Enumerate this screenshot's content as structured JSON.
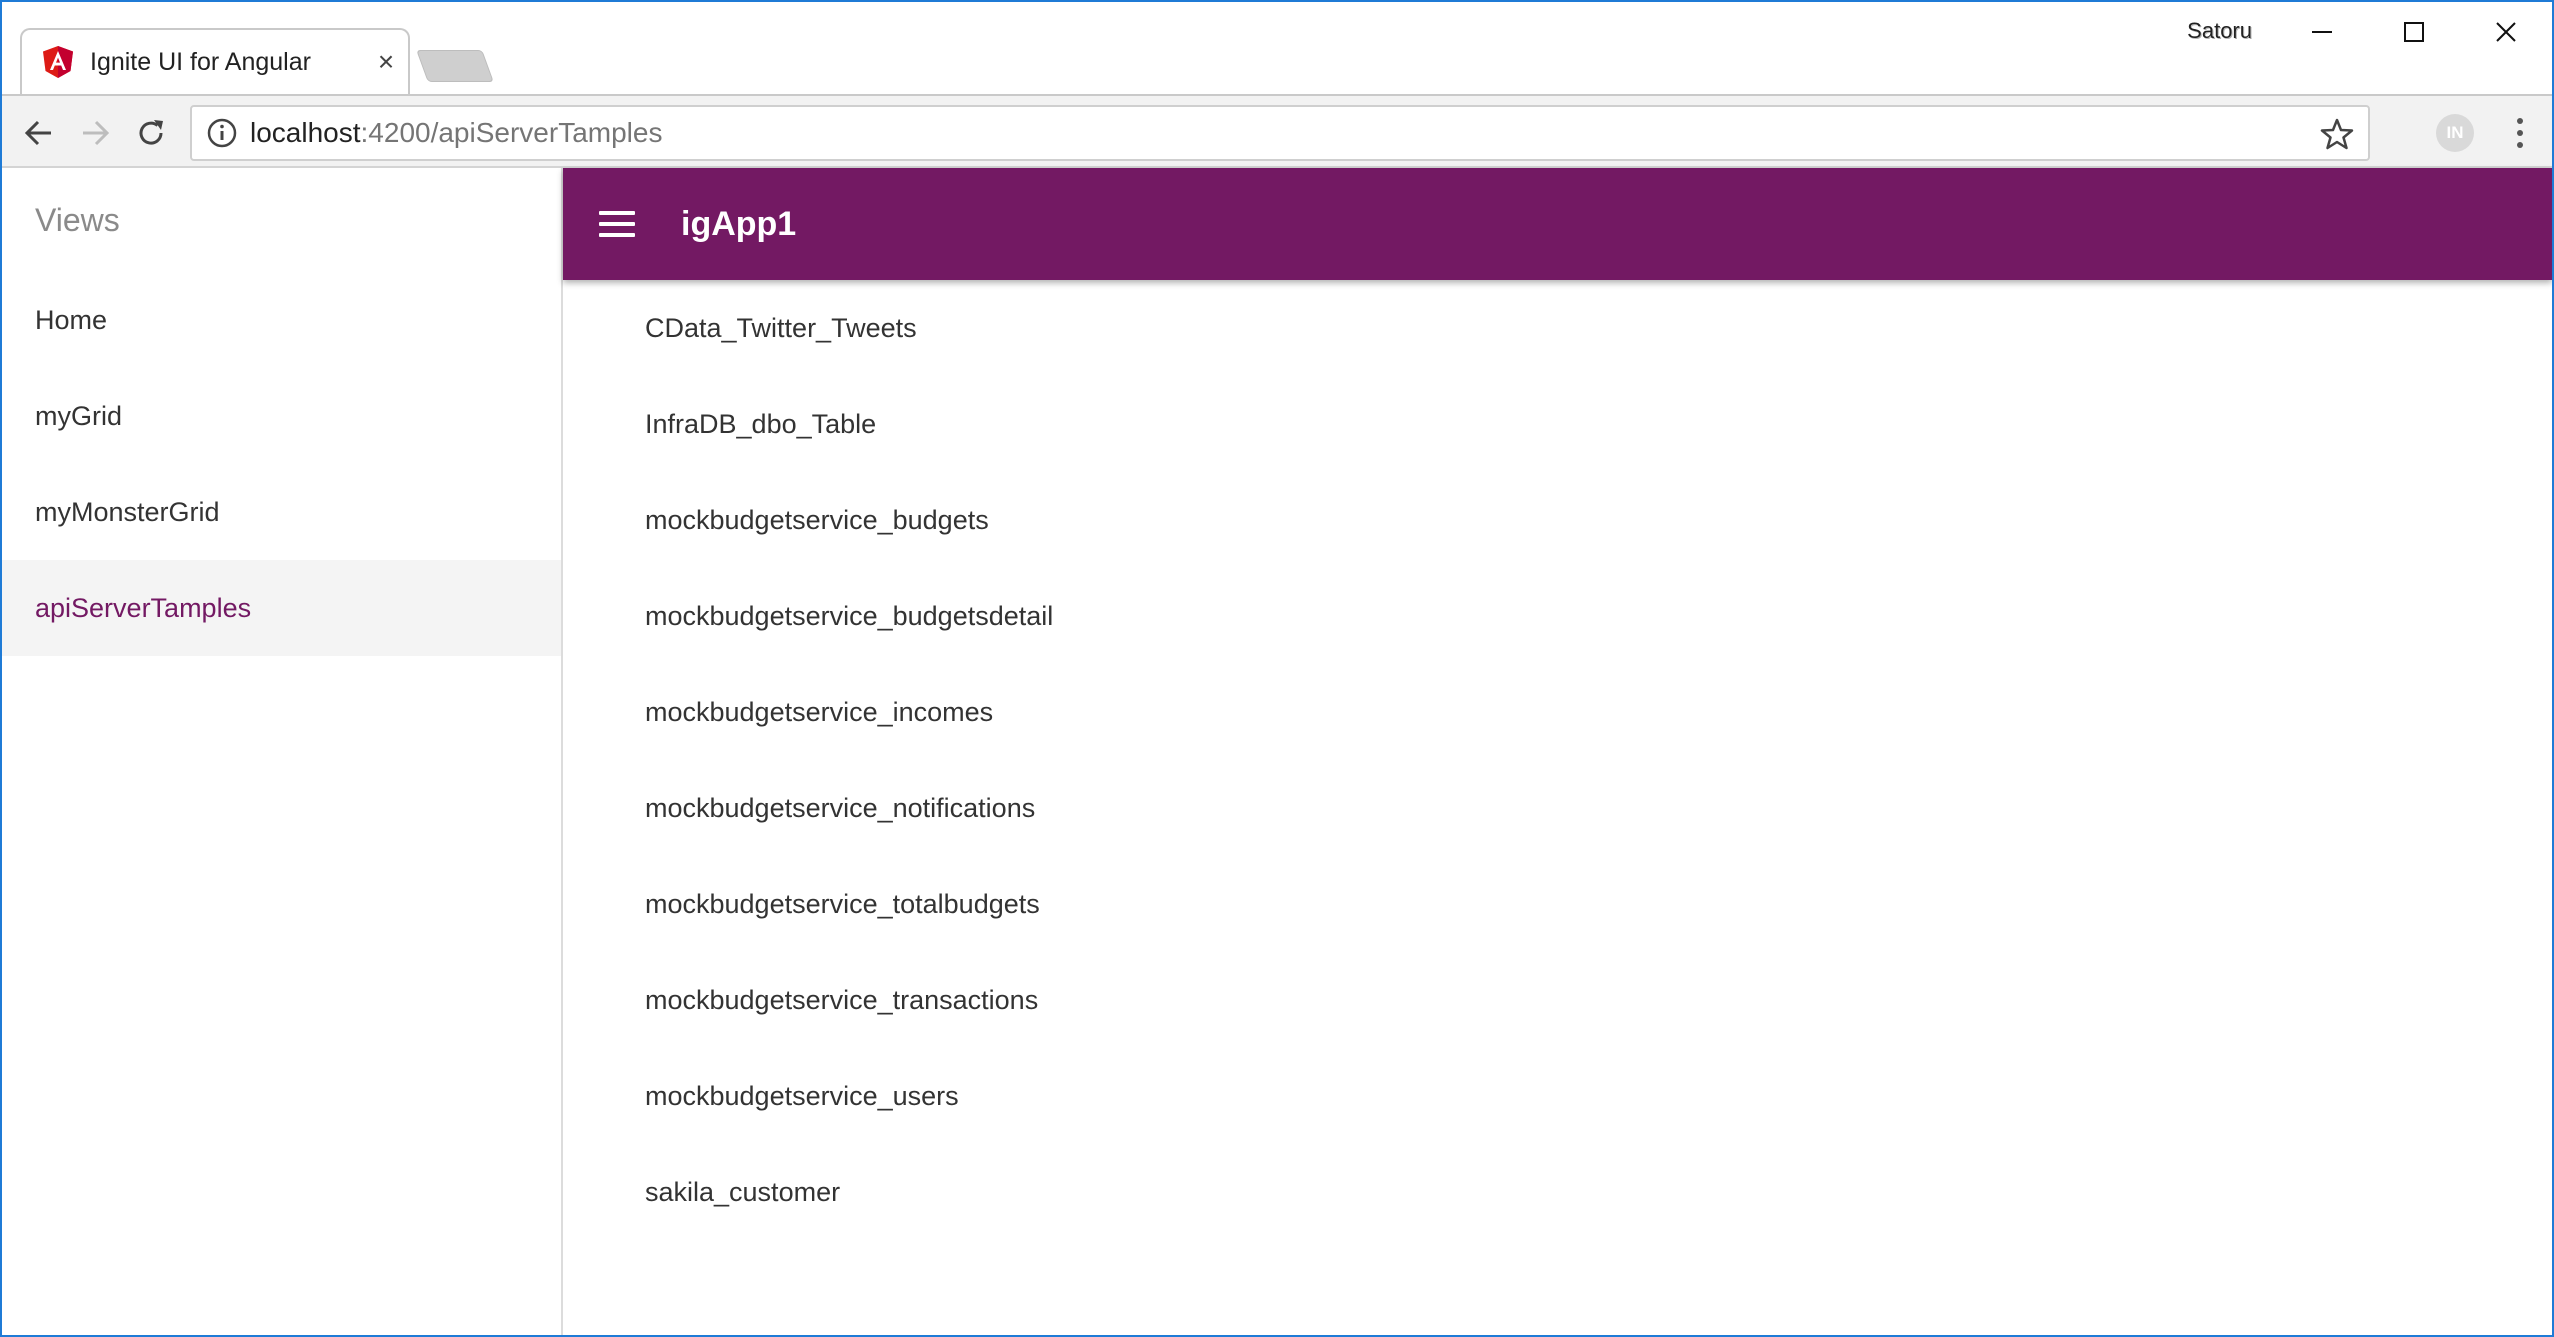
{
  "browser": {
    "tab_title": "Ignite UI for Angular",
    "tab_close": "×",
    "profile_name": "Satoru",
    "url_host": "localhost",
    "url_path": ":4200/apiServerTamples",
    "extension_label": "IN",
    "icons": {
      "favicon": "angular-logo-icon",
      "back": "arrow-left-icon",
      "forward": "arrow-right-icon",
      "reload": "reload-icon",
      "info": "info-icon",
      "bookmark": "star-icon",
      "menu": "more-vert-icon"
    }
  },
  "sidebar": {
    "header": "Views",
    "items": [
      {
        "label": "Home"
      },
      {
        "label": "myGrid"
      },
      {
        "label": "myMonsterGrid"
      },
      {
        "label": "apiServerTamples"
      }
    ],
    "active_index": 3
  },
  "navbar": {
    "title": "igApp1",
    "menu_icon": "hamburger-icon",
    "color": "#731963"
  },
  "main": {
    "items": [
      {
        "label": "CData_Twitter_Tweets"
      },
      {
        "label": "InfraDB_dbo_Table"
      },
      {
        "label": "mockbudgetservice_budgets"
      },
      {
        "label": "mockbudgetservice_budgetsdetail"
      },
      {
        "label": "mockbudgetservice_incomes"
      },
      {
        "label": "mockbudgetservice_notifications"
      },
      {
        "label": "mockbudgetservice_totalbudgets"
      },
      {
        "label": "mockbudgetservice_transactions"
      },
      {
        "label": "mockbudgetservice_users"
      },
      {
        "label": "sakila_customer"
      }
    ]
  },
  "colors": {
    "accent": "#731963",
    "window_border": "#1f7bd6",
    "active_item_bg": "#f4f4f4"
  }
}
